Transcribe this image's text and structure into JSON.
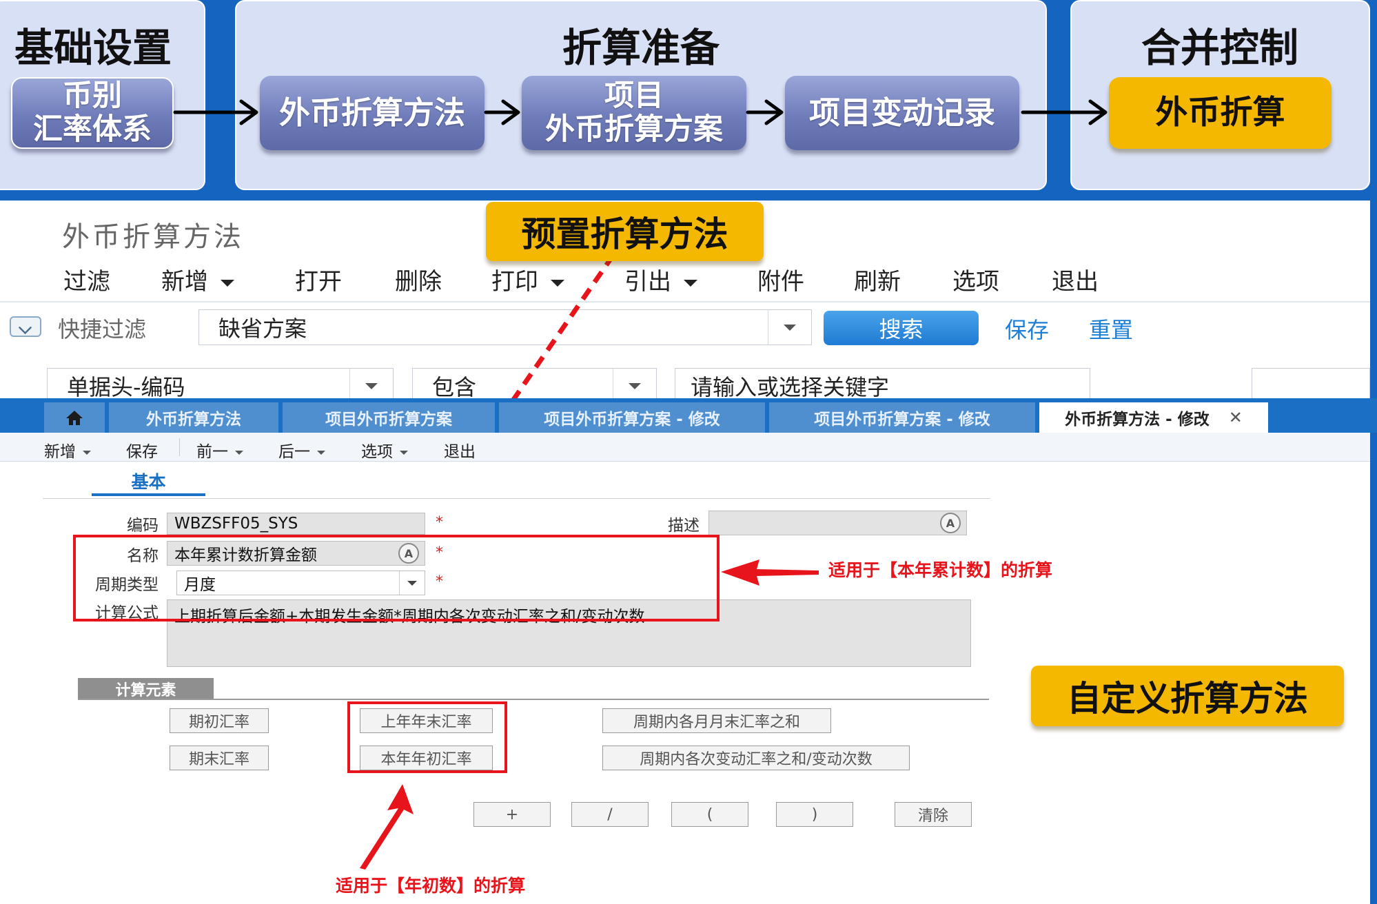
{
  "flow": {
    "stages": [
      "基础设置",
      "折算准备",
      "合并控制"
    ],
    "steps": {
      "currency": [
        "币别",
        "汇率体系"
      ],
      "method": "外币折算方法",
      "scheme": [
        "项目",
        "外币折算方案"
      ],
      "change": "项目变动记录",
      "translate": "外币折算"
    }
  },
  "callouts": {
    "preset": "预置折算方法",
    "custom": "自定义折算方法"
  },
  "list_view": {
    "title": "外币折算方法",
    "toolbar": [
      "过滤",
      "新增",
      "打开",
      "删除",
      "打印",
      "引出",
      "附件",
      "刷新",
      "选项",
      "退出"
    ],
    "quick_filter_label": "快捷过滤",
    "scheme_value": "缺省方案",
    "search_button": "搜索",
    "save_link": "保存",
    "reset_link": "重置",
    "field_select": "单据头-编码",
    "operator_select": "包含",
    "keyword_placeholder": "请输入或选择关键字"
  },
  "tabs": [
    "外币折算方法",
    "项目外币折算方案",
    "项目外币折算方案 - 修改",
    "项目外币折算方案 - 修改",
    "外币折算方法 - 修改"
  ],
  "edit_toolbar": [
    "新增",
    "保存",
    "前一",
    "后一",
    "选项",
    "退出"
  ],
  "form": {
    "section_tab": "基本",
    "code_label": "编码",
    "code_value": "WBZSFF05_SYS",
    "desc_label": "描述",
    "name_label": "名称",
    "name_value": "本年累计数折算金额",
    "period_label": "周期类型",
    "period_value": "月度",
    "formula_label": "计算公式",
    "formula_value": "上期折算后金额+本期发生金额*周期内各次变动汇率之和/变动次数",
    "required_mark": "*"
  },
  "calc_elements": {
    "title": "计算元素",
    "items": [
      "期初汇率",
      "期末汇率",
      "上年年末汇率",
      "本年年初汇率",
      "周期内各月月末汇率之和",
      "周期内各次变动汇率之和/变动次数"
    ],
    "operators": [
      "+",
      "/",
      "(",
      ")",
      "清除"
    ]
  },
  "annotations": {
    "ytd_note": "适用于【本年累计数】的折算",
    "opening_note": "适用于【年初数】的折算"
  },
  "colors": {
    "accent_gold": "#f5b800",
    "annotation_red": "#e8141c",
    "tab_blue": "#1a70c4",
    "link_blue": "#1e7fd6"
  }
}
